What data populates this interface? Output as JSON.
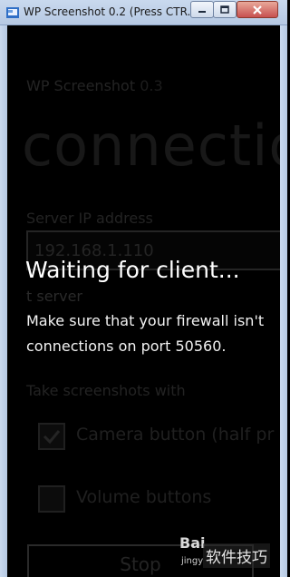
{
  "window": {
    "title": "WP Screenshot 0.2 (Press CTR..."
  },
  "app": {
    "name": "WP Screenshot",
    "version": "0.3",
    "page_title": "connectio",
    "server_ip_label": "Server IP address",
    "server_ip_value": "192.168.1.110",
    "info_line_1": "Make sure that your firewall isn't",
    "info_line_2": "connections on port 50560.",
    "info_line_faint": "t             server",
    "section_label": "Take screenshots with",
    "options": [
      {
        "label": "Camera button (half pr",
        "checked": true
      },
      {
        "label": "Volume buttons",
        "checked": false
      }
    ],
    "stop_label": "Stop"
  },
  "overlay": {
    "message": "Waiting for client..."
  },
  "watermark": {
    "brand": "Bai",
    "sub": "jingy",
    "tag": "软件技巧"
  }
}
